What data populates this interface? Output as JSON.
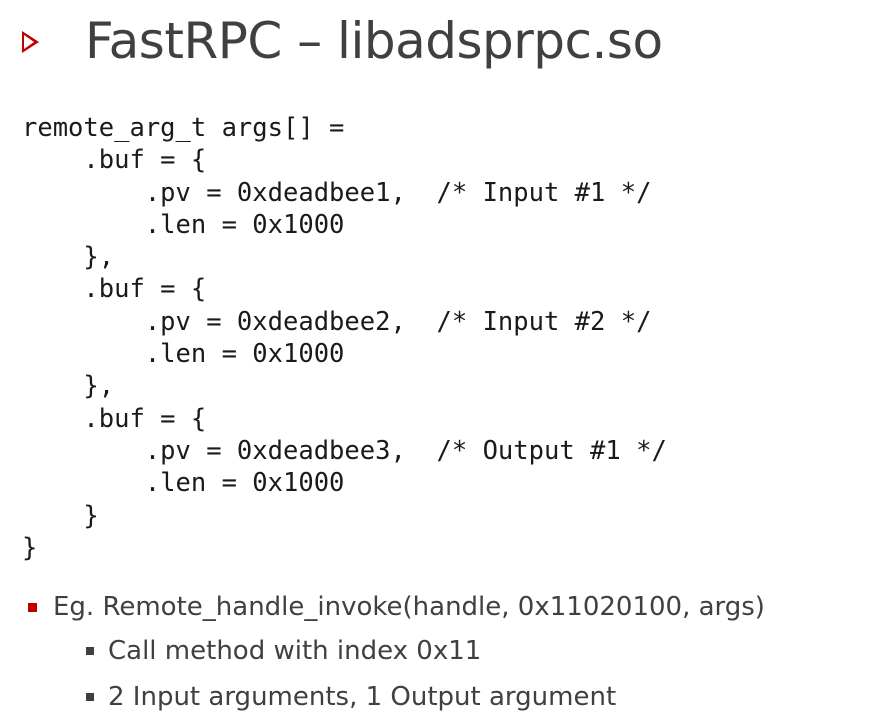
{
  "slide": {
    "title": "FastRPC – libadsprpc.so",
    "accent_color": "#c00000",
    "title_marker_icon": "triangle-outline-icon"
  },
  "code": {
    "lines": [
      "remote_arg_t args[] =",
      "    .buf = {",
      "        .pv = 0xdeadbee1,  /* Input #1 */",
      "        .len = 0x1000",
      "    },",
      "    .buf = {",
      "        .pv = 0xdeadbee2,  /* Input #2 */",
      "        .len = 0x1000",
      "    },",
      "    .buf = {",
      "        .pv = 0xdeadbee3,  /* Output #1 */",
      "        .len = 0x1000",
      "    }",
      "}"
    ]
  },
  "bullets": {
    "main": "Eg. Remote_handle_invoke(handle,  0x11020100, args)",
    "sub": [
      "Call method with index 0x11",
      "2 Input arguments, 1 Output argument"
    ]
  }
}
